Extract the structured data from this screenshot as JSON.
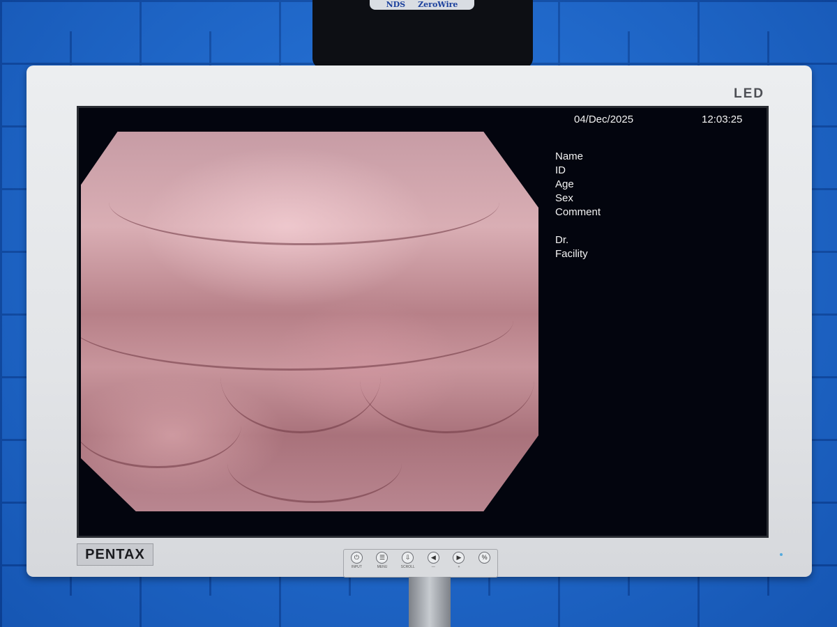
{
  "bracket": {
    "left_brand": "NDS",
    "right_brand": "ZeroWire"
  },
  "monitor": {
    "panel_label": "LED",
    "brand": "PENTAX"
  },
  "screen": {
    "date": "04/Dec/2025",
    "time": "12:03:25",
    "patient_fields": {
      "name": "Name",
      "id": "ID",
      "age": "Age",
      "sex": "Sex",
      "comment": "Comment",
      "doctor": "Dr.",
      "facility": "Facility"
    }
  },
  "controls": [
    {
      "icon": "input-icon",
      "glyph": "⏻",
      "label": "INPUT"
    },
    {
      "icon": "menu-icon",
      "glyph": "☰",
      "label": "MENU"
    },
    {
      "icon": "scroll-icon",
      "glyph": "⇩",
      "label": "SCROLL"
    },
    {
      "icon": "left-arrow-icon",
      "glyph": "◀",
      "label": "—"
    },
    {
      "icon": "right-arrow-icon",
      "glyph": "▶",
      "label": "+"
    },
    {
      "icon": "percent-icon",
      "glyph": "%",
      "label": ""
    }
  ],
  "colors": {
    "wall": "#1d6cd4",
    "bezel": "#e6e8eb",
    "screen": "#03050e",
    "overlay_text": "#f2f2f2"
  }
}
